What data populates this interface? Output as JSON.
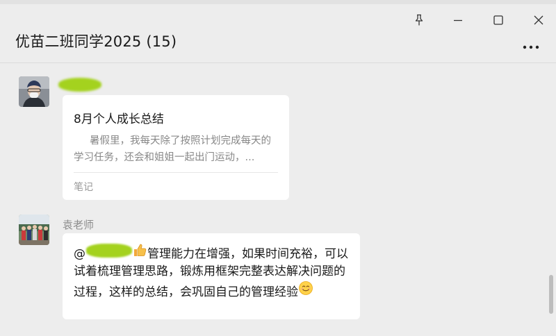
{
  "window": {
    "title": "优苗二班同学2025 (15)",
    "controls": [
      "pin-icon",
      "minimize-icon",
      "maximize-icon",
      "close-icon"
    ],
    "more_icon": "more-dots-icon"
  },
  "messages": [
    {
      "type": "note_card",
      "card": {
        "title": "8月个人成长总结",
        "preview": "     暑假里，我每天除了按照计划完成每天的学习任务，还会和姐姐一起出门运动，...",
        "footer": "笔记"
      }
    },
    {
      "type": "text",
      "sender": "袁老师",
      "text": {
        "at": "@",
        "body": "管理能力在增强，如果时间充裕，可以试着梳理管理思路，锻炼用框架完整表达解决问题的过程，这样的总结，会巩固自己的管理经验"
      },
      "emojis": [
        "thumbs-up-icon",
        "smile-icon"
      ]
    }
  ],
  "colors": {
    "background": "#ededed",
    "bubble": "#ffffff",
    "redaction": "#a4d21e"
  }
}
